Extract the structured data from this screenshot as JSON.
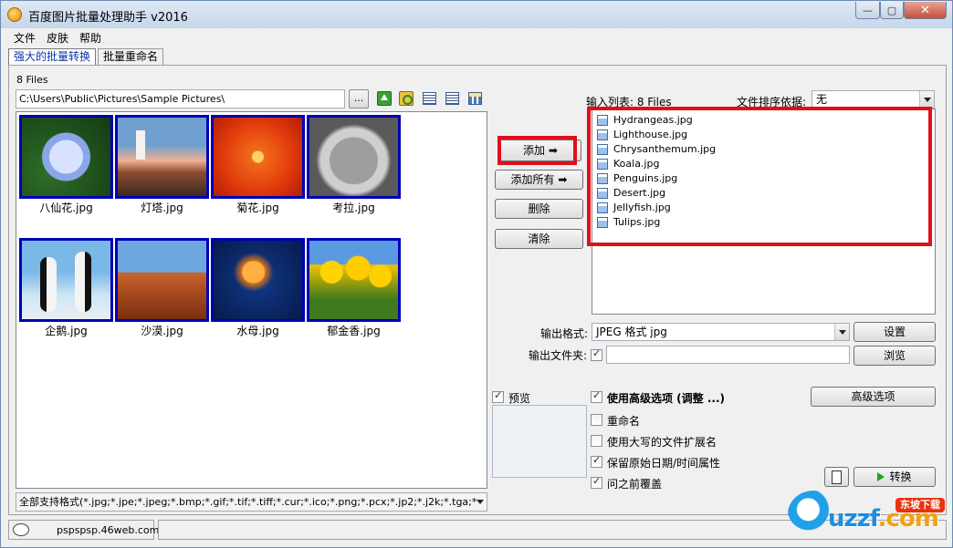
{
  "window": {
    "title": "百度图片批量处理助手  v2016",
    "controls": {
      "minimize": "—",
      "maximize": "▢",
      "close": "✕"
    }
  },
  "menu": [
    "文件",
    "皮肤",
    "帮助"
  ],
  "tabs": [
    {
      "label": "强大的批量转换",
      "active": true
    },
    {
      "label": "批量重命名",
      "active": false
    }
  ],
  "browser": {
    "files_count": "8 Files",
    "path": "C:\\Users\\Public\\Pictures\\Sample Pictures\\",
    "browse_label": "...",
    "icons": [
      "folder-up-icon",
      "refresh-icon",
      "list-view-icon",
      "details-view-icon",
      "thumbnail-view-icon"
    ]
  },
  "thumbnails": [
    {
      "label": "八仙花.jpg"
    },
    {
      "label": "灯塔.jpg"
    },
    {
      "label": "菊花.jpg"
    },
    {
      "label": "考拉.jpg"
    },
    {
      "label": "企鹅.jpg"
    },
    {
      "label": "沙漠.jpg"
    },
    {
      "label": "水母.jpg"
    },
    {
      "label": "郁金香.jpg"
    }
  ],
  "format_filter": "全部支持格式(*.jpg;*.jpe;*.jpeg;*.bmp;*.gif;*.tif;*.tiff;*.cur;*.ico;*.png;*.pcx;*.jp2;*.j2k;*.tga;*",
  "actions": {
    "add": "添加",
    "add_all": "添加所有",
    "delete": "删除",
    "clear": "清除"
  },
  "input_list": {
    "label": "输入列表: 8 Files",
    "sort_label": "文件排序依据:",
    "sort_value": "无",
    "files": [
      "Hydrangeas.jpg",
      "Lighthouse.jpg",
      "Chrysanthemum.jpg",
      "Koala.jpg",
      "Penguins.jpg",
      "Desert.jpg",
      "Jellyfish.jpg",
      "Tulips.jpg"
    ]
  },
  "output": {
    "format_label": "输出格式:",
    "format_value": "JPEG 格式 jpg",
    "settings_button": "设置",
    "folder_label": "输出文件夹:",
    "folder_checked": true,
    "folder_value": "",
    "browse_button": "浏览"
  },
  "preview": {
    "label": "预览",
    "checked": true
  },
  "options": [
    {
      "label": "使用高级选项 (调整 ...)",
      "checked": true,
      "bold": true
    },
    {
      "label": "重命名",
      "checked": false,
      "bold": false
    },
    {
      "label": "使用大写的文件扩展名",
      "checked": false,
      "bold": false
    },
    {
      "label": "保留原始日期/时间属性",
      "checked": true,
      "bold": false
    },
    {
      "label": "问之前覆盖",
      "checked": true,
      "bold": false
    }
  ],
  "advanced_button": "高级选项",
  "convert_button": "转换",
  "status": {
    "text": "pspspsp.46web.com"
  },
  "watermark": {
    "badge": "东坡下载",
    "text_a": "uzzf",
    "text_b": ".com"
  },
  "colors": {
    "highlight_red": "#e0101a",
    "thumb_border": "#0000b4",
    "active_tab_text": "#0a36a8"
  }
}
